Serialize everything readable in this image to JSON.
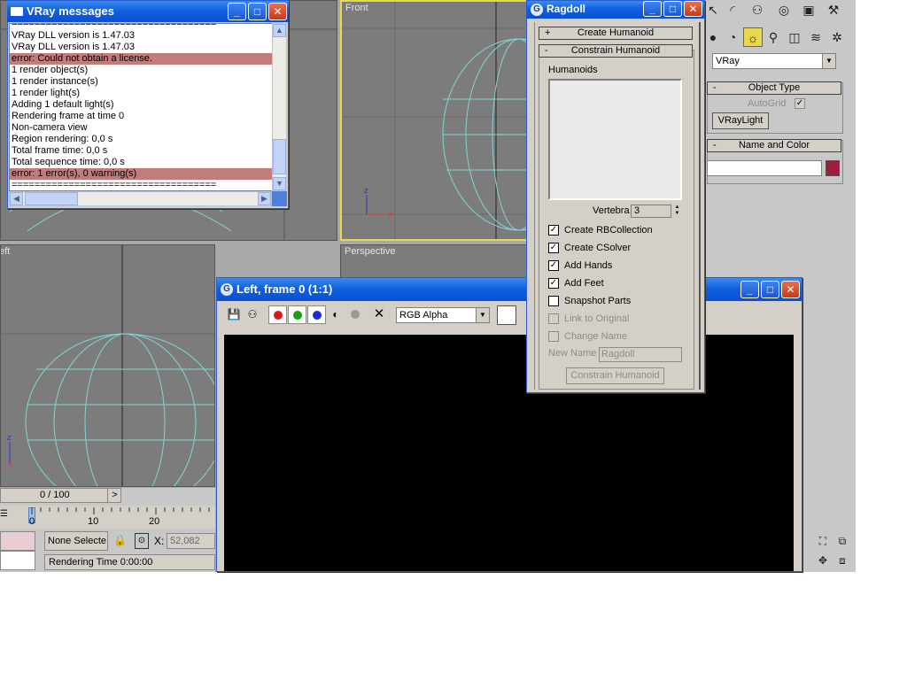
{
  "colors": {
    "title_blue": "#1160e0",
    "grid_cyan": "#7fd7d3",
    "error_row": "#c27c7c",
    "accent_swatch": "#9b1e3c"
  },
  "viewports": {
    "front_label": "Front",
    "perspective_label": "Perspective",
    "left_label": "eft"
  },
  "vray_window": {
    "title": "VRay messages",
    "lines": [
      {
        "text": "====================================",
        "error": false
      },
      {
        "text": "VRay DLL version is 1.47.03",
        "error": false
      },
      {
        "text": "VRay DLL version is 1.47.03",
        "error": false
      },
      {
        "text": "error: Could not obtain a license.",
        "error": true
      },
      {
        "text": "1 render object(s)",
        "error": false
      },
      {
        "text": "1 render instance(s)",
        "error": false
      },
      {
        "text": "1 render light(s)",
        "error": false
      },
      {
        "text": "Adding 1 default light(s)",
        "error": false
      },
      {
        "text": "Rendering frame at time 0",
        "error": false
      },
      {
        "text": "Non-camera view",
        "error": false
      },
      {
        "text": "Region rendering: 0,0 s",
        "error": false
      },
      {
        "text": "Total frame time: 0,0 s",
        "error": false
      },
      {
        "text": "Total sequence time: 0,0 s",
        "error": false
      },
      {
        "text": "error: 1 error(s), 0 warning(s)",
        "error": true
      },
      {
        "text": "====================================",
        "error": false
      }
    ]
  },
  "ragdoll": {
    "title": "Ragdoll",
    "create_rollout": "Create Humanoid",
    "constrain_rollout": "Constrain Humanoid",
    "humanoids_label": "Humanoids",
    "vertebra_label": "Vertebra",
    "vertebra_value": "3",
    "options": [
      {
        "label": "Create RBCollection",
        "checked": true,
        "enabled": true
      },
      {
        "label": "Create CSolver",
        "checked": true,
        "enabled": true
      },
      {
        "label": "Add Hands",
        "checked": true,
        "enabled": true
      },
      {
        "label": "Add Feet",
        "checked": true,
        "enabled": true
      },
      {
        "label": "Snapshot Parts",
        "checked": false,
        "enabled": true
      },
      {
        "label": "Link to Original",
        "checked": false,
        "enabled": false
      },
      {
        "label": "Change Name",
        "checked": false,
        "enabled": false
      }
    ],
    "new_name_label": "New Name",
    "new_name_value": "Ragdoll",
    "constrain_button": "Constrain Humanoid",
    "plus": "+",
    "minus": "-"
  },
  "frame_window": {
    "title": "Left, frame 0 (1:1)",
    "channel": "RGB Alpha"
  },
  "command_panel": {
    "renderer": "VRay",
    "object_type_title": "Object Type",
    "autogrid_label": "AutoGrid",
    "vraylight_button": "VRayLight",
    "name_color_title": "Name and Color",
    "minus": "-"
  },
  "timeline": {
    "frame_counter": "0 / 100",
    "next_arrow": ">",
    "ticks": [
      "0",
      "10",
      "20"
    ],
    "selection": "None Selecte",
    "x_label": "X:",
    "x_value": "52,082",
    "rendering_time": "Rendering Time  0:00:00"
  }
}
